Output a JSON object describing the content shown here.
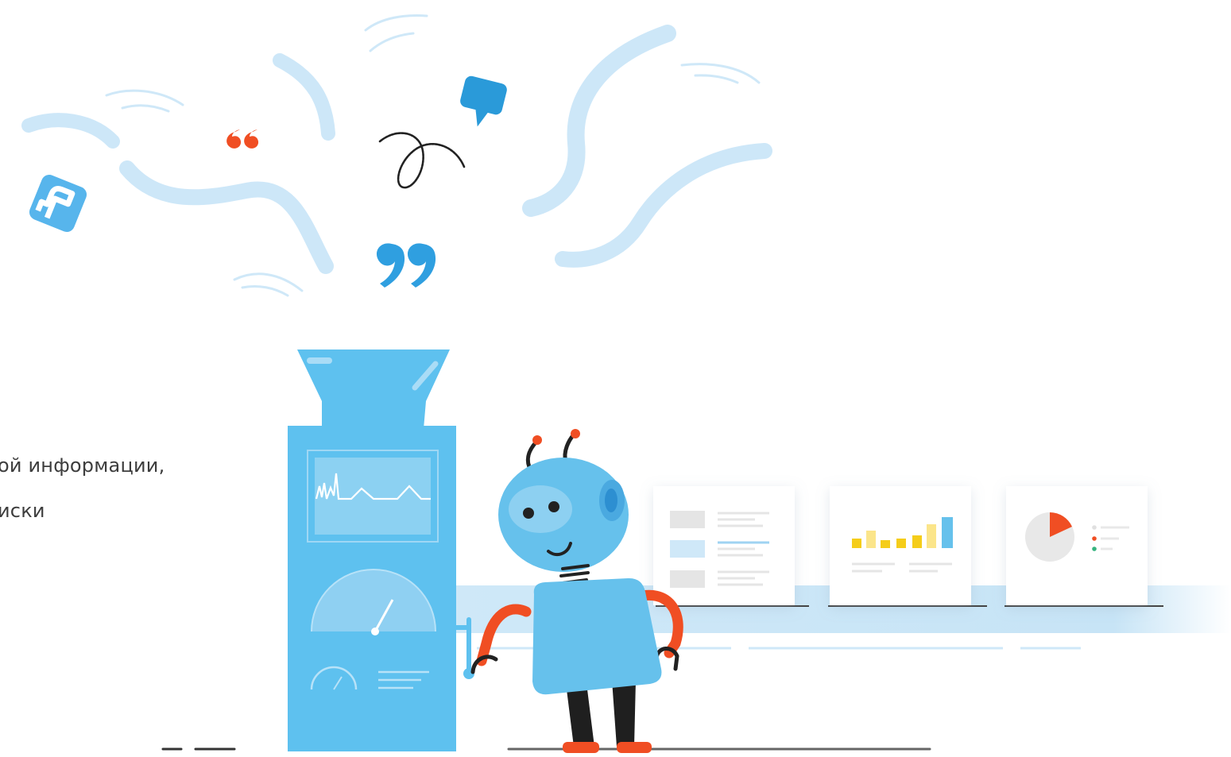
{
  "caption": {
    "line1": "ой информации,",
    "line2": "иски"
  },
  "colors": {
    "light_blue": "#cfe8f8",
    "machine_blue": "#5ec1ef",
    "robot_blue": "#66c1ec",
    "accent_red": "#f04e23",
    "bar_yellow": "#f5cd1a",
    "icon_blue": "#2a9ad9",
    "dark": "#222222"
  },
  "icons": [
    "social-share-icon",
    "opening-quote-icon",
    "closing-quote-icon",
    "speech-bubble-icon",
    "scribble-icon"
  ]
}
